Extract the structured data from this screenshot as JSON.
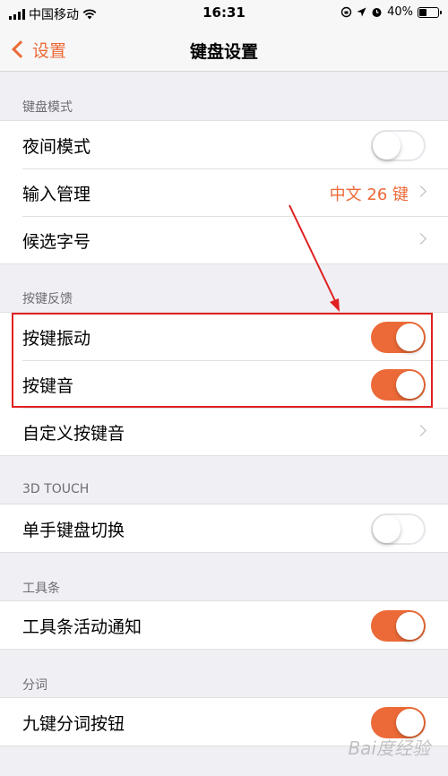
{
  "status": {
    "carrier": "中国移动",
    "time": "16:31",
    "battery": "40%",
    "battery_level": 0.4
  },
  "nav": {
    "back_label": "设置",
    "title": "键盘设置"
  },
  "sections": [
    {
      "header": "键盘模式",
      "rows": [
        {
          "label": "夜间模式"
        },
        {
          "label": "输入管理",
          "value": "中文 26 键"
        },
        {
          "label": "候选字号"
        }
      ]
    },
    {
      "header": "按键反馈",
      "rows": [
        {
          "label": "按键振动"
        },
        {
          "label": "按键音"
        },
        {
          "label": "自定义按键音"
        }
      ]
    },
    {
      "header": "3D TOUCH",
      "rows": [
        {
          "label": "单手键盘切换"
        }
      ]
    },
    {
      "header": "工具条",
      "rows": [
        {
          "label": "工具条活动通知"
        }
      ]
    },
    {
      "header": "分词",
      "rows": [
        {
          "label": "九键分词按钮"
        }
      ]
    }
  ],
  "toggles": {
    "night_mode": false,
    "key_vibration": true,
    "key_sound": true,
    "one_hand_switch": false,
    "toolbar_notify": true,
    "nine_key_seg": true
  },
  "colors": {
    "accent": "#ec6a37",
    "annotation": "#e02020"
  },
  "watermark": "Bai度经验"
}
